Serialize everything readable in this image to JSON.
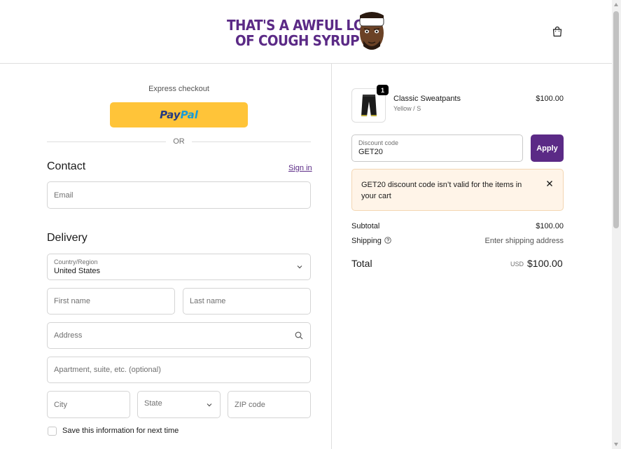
{
  "header": {
    "logo_line1": "THAT'S A AWFUL LOT",
    "logo_line2": "OF COUGH SYRUP",
    "brand_color": "#5b2a86",
    "cart_icon": "shopping-bag-icon"
  },
  "express": {
    "label": "Express checkout",
    "paypal_part1": "Pay",
    "paypal_part2": "Pal",
    "or_text": "OR"
  },
  "contact": {
    "title": "Contact",
    "sign_in": "Sign in",
    "email_placeholder": "Email"
  },
  "delivery": {
    "title": "Delivery",
    "country_label": "Country/Region",
    "country_value": "United States",
    "first_name_placeholder": "First name",
    "last_name_placeholder": "Last name",
    "address_placeholder": "Address",
    "apartment_placeholder": "Apartment, suite, etc. (optional)",
    "city_placeholder": "City",
    "state_placeholder": "State",
    "zip_placeholder": "ZIP code",
    "save_info": "Save this information for next time"
  },
  "order": {
    "item": {
      "quantity": "1",
      "name": "Classic Sweatpants",
      "variant": "Yellow / S",
      "price": "$100.00"
    },
    "discount": {
      "label": "Discount code",
      "value": "GET20",
      "apply": "Apply"
    },
    "notice": "GET20 discount code isn’t valid for the items in your cart",
    "subtotal_label": "Subtotal",
    "subtotal_value": "$100.00",
    "shipping_label": "Shipping",
    "shipping_value": "Enter shipping address",
    "total_label": "Total",
    "total_currency": "USD",
    "total_value": "$100.00"
  },
  "colors": {
    "accent": "#5b2a86",
    "paypal": "#ffc439",
    "notice_bg": "#fff4e8"
  }
}
